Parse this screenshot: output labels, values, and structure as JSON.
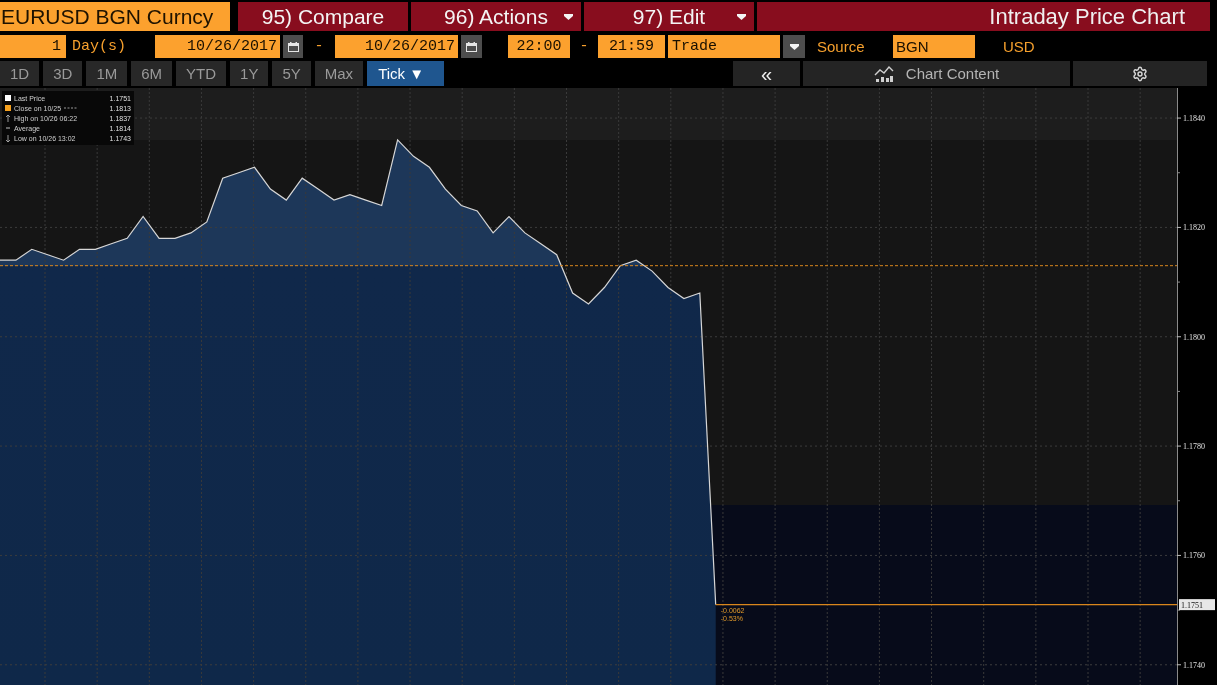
{
  "header": {
    "security": "EURUSD BGN Curncy",
    "menus": [
      {
        "label": "95) Compare",
        "dropdown": false
      },
      {
        "label": "96) Actions",
        "dropdown": true
      },
      {
        "label": "97) Edit",
        "dropdown": true
      }
    ],
    "title": "Intraday Price Chart"
  },
  "range_bar": {
    "count": "1",
    "unit": "Day(s)",
    "start_date": "10/26/2017",
    "date_separator": "-",
    "end_date": "10/26/2017",
    "start_time": "22:00",
    "time_separator": "-",
    "end_time": "21:59",
    "price_type": "Trade",
    "source_label": "Source",
    "source": "BGN",
    "currency": "USD"
  },
  "periods": [
    {
      "label": "1D",
      "selected": false
    },
    {
      "label": "3D",
      "selected": false
    },
    {
      "label": "1M",
      "selected": false
    },
    {
      "label": "6M",
      "selected": false
    },
    {
      "label": "YTD",
      "selected": false
    },
    {
      "label": "1Y",
      "selected": false
    },
    {
      "label": "5Y",
      "selected": false
    },
    {
      "label": "Max",
      "selected": false
    },
    {
      "label": "Tick ▼",
      "selected": true
    }
  ],
  "toolbar": {
    "collapse": "«",
    "chart_content": "Chart Content"
  },
  "chart": {
    "legend": [
      {
        "kind": "last",
        "label": "Last Price",
        "value": "1.1751",
        "color": "#ffffff"
      },
      {
        "kind": "close",
        "label": "Close on 10/25",
        "value": "1.1813",
        "color": "#f5a11f"
      },
      {
        "kind": "high",
        "label": "High on 10/26 06:22",
        "value": "1.1837"
      },
      {
        "kind": "average",
        "label": "Average",
        "value": "1.1814"
      },
      {
        "kind": "low",
        "label": "Low on 10/26 13:02",
        "value": "1.1743"
      }
    ],
    "chart_data": {
      "type": "area",
      "categories": [
        null,
        null,
        null,
        null,
        null,
        null,
        null,
        null,
        null,
        null,
        null,
        null,
        null,
        null,
        null,
        null,
        null,
        null,
        null,
        null,
        null,
        null,
        null,
        null,
        null,
        null,
        null,
        null,
        null,
        null,
        null,
        null,
        null,
        null,
        null,
        null,
        null,
        null,
        null,
        null,
        null,
        null,
        null,
        null,
        null,
        null,
        null,
        null,
        null,
        null,
        null,
        null,
        null,
        null,
        null,
        null,
        null,
        null,
        null,
        null,
        null,
        null,
        null,
        null,
        null,
        null,
        null,
        null,
        null,
        null,
        null,
        null,
        null,
        null
      ],
      "series": [
        {
          "color": "#d6d6d6",
          "values": [
            1.1814,
            1.1814,
            1.1816,
            1.1815,
            1.1814,
            1.1816,
            1.1816,
            1.1817,
            1.1818,
            1.1822,
            1.1818,
            1.1818,
            1.1819,
            1.1821,
            1.1829,
            1.183,
            1.1831,
            1.1827,
            1.1825,
            1.1829,
            1.1827,
            1.1825,
            1.1826,
            1.1825,
            1.1824,
            1.1836,
            1.1833,
            1.1831,
            1.1827,
            1.1824,
            1.1823,
            1.1819,
            1.1822,
            1.1819,
            1.1817,
            1.1815,
            1.1808,
            1.1806,
            1.1809,
            1.1813,
            1.1814,
            1.1812,
            1.1809,
            1.1807,
            1.1808,
            1.1751,
            null,
            null,
            null,
            null,
            null,
            null,
            null,
            null,
            null,
            null,
            null,
            null,
            null,
            null,
            null,
            null,
            null,
            null,
            null,
            null,
            null,
            null,
            null,
            null,
            null,
            null,
            null,
            null
          ]
        }
      ],
      "ylim": [
        1.17363,
        1.18455
      ],
      "yticks": [
        {
          "value": 1.184,
          "label": "1.1840"
        },
        {
          "value": 1.182,
          "label": "1.1820"
        },
        {
          "value": 1.18,
          "label": "1.1800"
        },
        {
          "value": 1.178,
          "label": "1.1780"
        },
        {
          "value": 1.176,
          "label": "1.1760"
        },
        {
          "value": 1.174,
          "label": "1.1740"
        }
      ],
      "grid": true,
      "ref_lines": [
        {
          "axis": "y",
          "value": 1.1813
        },
        {
          "axis": "y",
          "value": 1.1751,
          "label": "1.1751"
        }
      ],
      "annotations": [
        {
          "text": "-0.0062"
        },
        {
          "text": "-0.53%"
        }
      ]
    }
  }
}
